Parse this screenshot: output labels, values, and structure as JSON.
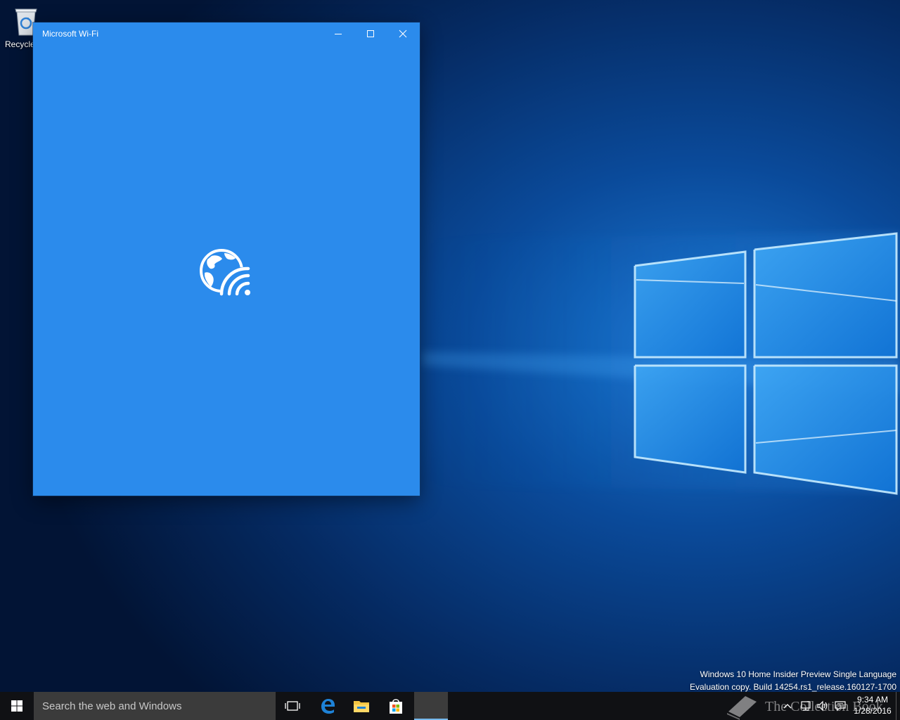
{
  "desktop": {
    "icons": [
      {
        "label": "Recycle",
        "icon": "recycle-bin-icon"
      }
    ]
  },
  "window": {
    "title": "Microsoft Wi-Fi",
    "background": "#2b8bec",
    "controls": {
      "minimize": "minimize-icon",
      "maximize": "maximize-icon",
      "close": "close-icon"
    },
    "splash_icon": "globe-wifi-icon"
  },
  "watermark": {
    "line1": "Windows 10 Home Insider Preview Single Language",
    "line2": "Evaluation copy. Build 14254.rs1_release.160127-1700"
  },
  "taskbar": {
    "start_icon": "windows-logo-icon",
    "search_placeholder": "Search the web and Windows",
    "pinned": [
      {
        "name": "Task View",
        "icon": "task-view-icon"
      },
      {
        "name": "Microsoft Edge",
        "icon": "edge-icon"
      },
      {
        "name": "File Explorer",
        "icon": "folder-icon"
      },
      {
        "name": "Store",
        "icon": "store-icon"
      },
      {
        "name": "Microsoft Wi-Fi",
        "icon": "wifi-app-icon",
        "active": true
      }
    ],
    "overlay_text": "The Collection Book",
    "tray": {
      "icons": [
        "chevron-up-icon",
        "network-icon",
        "volume-icon",
        "action-center-icon"
      ],
      "time": "9:34 AM",
      "date": "1/28/2016"
    }
  },
  "colors": {
    "accent": "#2b8bec",
    "taskbar": "#101114",
    "search_box": "#3b3b3b",
    "active_indicator": "#76b9ed"
  }
}
